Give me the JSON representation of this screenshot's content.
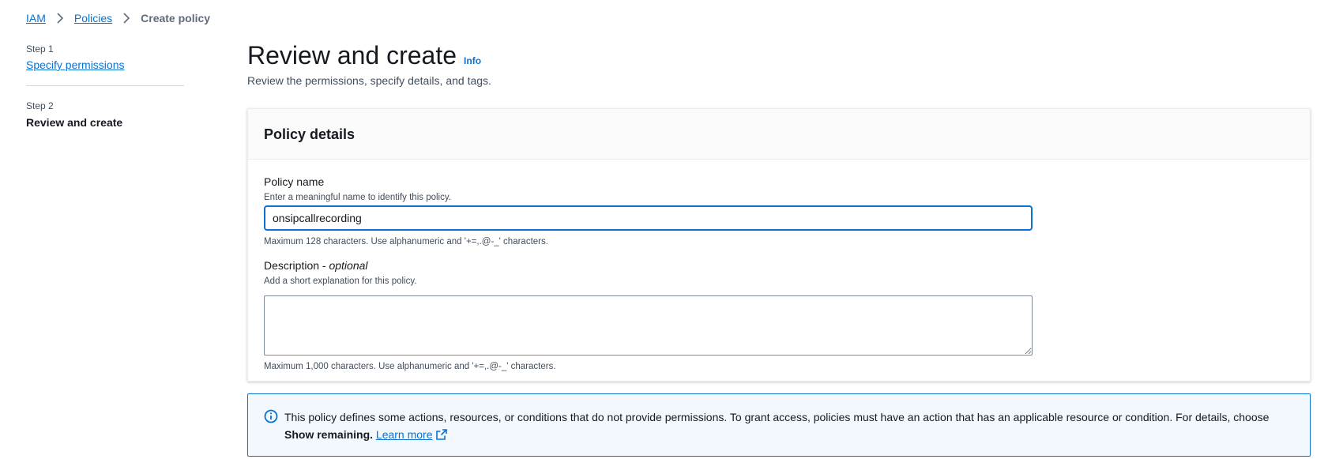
{
  "breadcrumb": {
    "items": [
      {
        "label": "IAM"
      },
      {
        "label": "Policies"
      },
      {
        "label": "Create policy"
      }
    ]
  },
  "steps": {
    "step1": {
      "caption": "Step 1",
      "label": "Specify permissions"
    },
    "step2": {
      "caption": "Step 2",
      "label": "Review and create"
    }
  },
  "header": {
    "title": "Review and create",
    "info_label": "Info",
    "description": "Review the permissions, specify details, and tags."
  },
  "policy_details": {
    "title": "Policy details",
    "name_field": {
      "label": "Policy name",
      "description": "Enter a meaningful name to identify this policy.",
      "value": "onsipcallrecording",
      "hint": "Maximum 128 characters. Use alphanumeric and '+=,.@-_' characters."
    },
    "description_field": {
      "label": "Description - ",
      "label_optional": "optional",
      "description": "Add a short explanation for this policy.",
      "value": "",
      "hint": "Maximum 1,000 characters. Use alphanumeric and '+=,.@-_' characters."
    }
  },
  "alert": {
    "text_before": "This policy defines some actions, resources, or conditions that do not provide permissions. To grant access, policies must have an action that has an applicable resource or condition. For details, choose ",
    "bold_text": "Show remaining.",
    "link_label": "Learn more",
    "icon": "info-icon",
    "link_icon": "external-link-icon"
  },
  "colors": {
    "link": "#0972d3",
    "alert_bg": "#f2f8fd",
    "text": "#16191f"
  }
}
